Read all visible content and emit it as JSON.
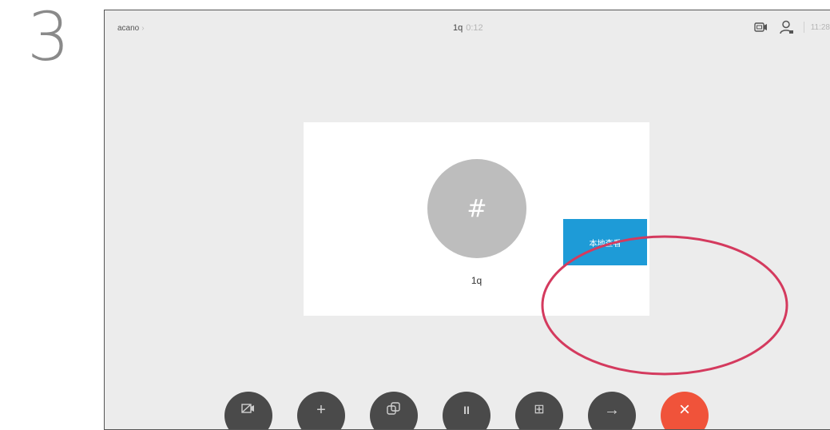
{
  "step": {
    "number": "3"
  },
  "topbar": {
    "breadcrumb": {
      "label": "acano",
      "chevron_icon": "chevron-right-icon"
    },
    "call": {
      "name": "1q",
      "duration": "0:12"
    },
    "status": {
      "camera_icon": "camera-icon",
      "participants_icon": "participant-icon",
      "time": "11:28"
    }
  },
  "card": {
    "avatar_glyph": "#",
    "name": "1q",
    "action_label": "本地查看"
  },
  "toolbar": {
    "buttons": [
      {
        "icon": "camera-off-icon"
      },
      {
        "icon": "add-icon",
        "glyph": "+"
      },
      {
        "icon": "share-screen-icon"
      },
      {
        "icon": "pause-icon",
        "glyph": "II"
      },
      {
        "icon": "keypad-icon",
        "glyph": "⊞"
      },
      {
        "icon": "transfer-icon",
        "glyph": "→"
      },
      {
        "icon": "end-call-icon",
        "glyph": "×"
      }
    ]
  },
  "colors": {
    "background": "#ececec",
    "accent": "#1e9bd7",
    "end_call": "#f0533a",
    "highlight": "#d43a5e"
  }
}
